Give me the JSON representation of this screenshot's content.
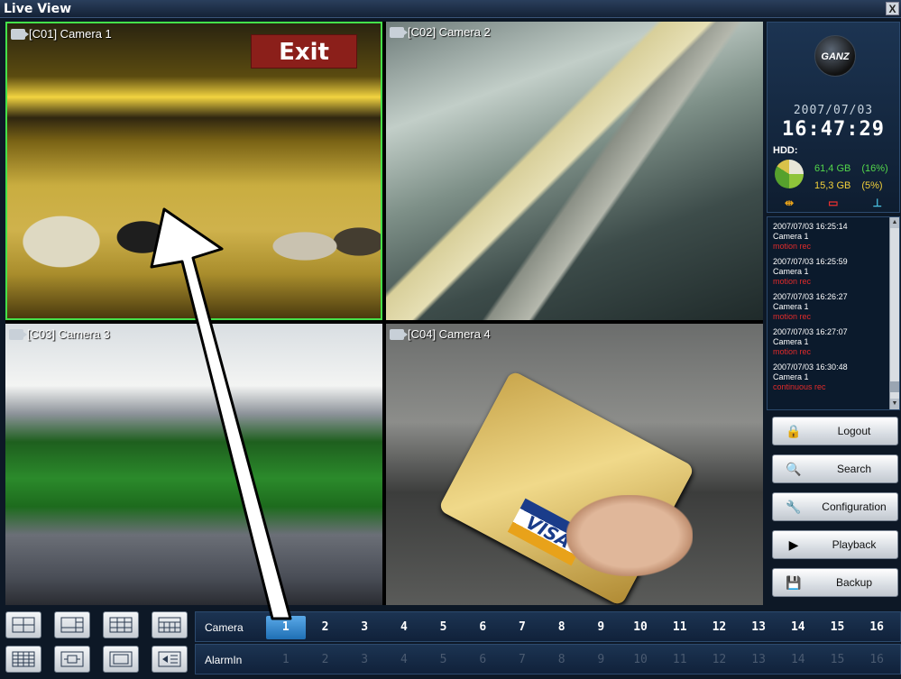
{
  "window": {
    "title": "Live View",
    "close_label": "X"
  },
  "cameras": [
    {
      "label": "[C01] Camera 1",
      "overlay_text": "Exit"
    },
    {
      "label": "[C02] Camera 2"
    },
    {
      "label": "[C03] Camera 3"
    },
    {
      "label": "[C04] Camera 4",
      "overlay_text": "VISA"
    }
  ],
  "info": {
    "logo_text": "GANZ",
    "date": "2007/07/03",
    "time": "16:47:29",
    "hdd_label": "HDD:",
    "hdd_rows": [
      {
        "size": "61,4 GB",
        "percent": "(16%)"
      },
      {
        "size": "15,3 GB",
        "percent": "(5%)"
      }
    ]
  },
  "log": [
    {
      "time": "2007/07/03 16:25:14",
      "camera": "Camera 1",
      "type": "motion rec"
    },
    {
      "time": "2007/07/03 16:25:59",
      "camera": "Camera 1",
      "type": "motion rec"
    },
    {
      "time": "2007/07/03 16:26:27",
      "camera": "Camera 1",
      "type": "motion rec"
    },
    {
      "time": "2007/07/03 16:27:07",
      "camera": "Camera 1",
      "type": "motion rec"
    },
    {
      "time": "2007/07/03 16:30:48",
      "camera": "Camera 1",
      "type": "continuous rec"
    }
  ],
  "buttons": [
    {
      "label": "Logout",
      "icon": "lock-icon"
    },
    {
      "label": "Search",
      "icon": "magnifier-icon"
    },
    {
      "label": "Configuration",
      "icon": "wrench-icon"
    },
    {
      "label": "Playback",
      "icon": "playback-1ch-icon"
    },
    {
      "label": "Backup",
      "icon": "instant-backup-icon"
    }
  ],
  "bottom": {
    "camera_label": "Camera",
    "alarm_label": "AlarmIn",
    "numbers": [
      "1",
      "2",
      "3",
      "4",
      "5",
      "6",
      "7",
      "8",
      "9",
      "10",
      "11",
      "12",
      "13",
      "14",
      "15",
      "16"
    ],
    "active_camera": "1",
    "layouts": [
      "layout-4-icon",
      "layout-6-icon",
      "layout-9-icon",
      "layout-10-icon",
      "layout-16-icon",
      "layout-pip-icon",
      "layout-fullscreen-icon",
      "layout-sequence-icon"
    ]
  }
}
